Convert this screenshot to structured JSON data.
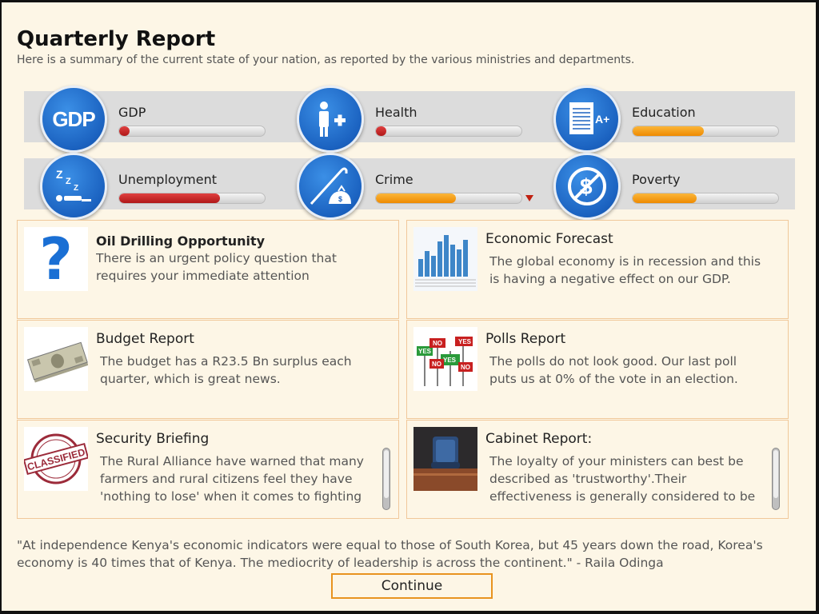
{
  "header": {
    "title": "Quarterly Report",
    "subtitle": "Here is a summary of the current state of your nation, as reported by the various ministries and departments."
  },
  "indicators": [
    {
      "label": "GDP",
      "icon": "gdp-icon",
      "icon_text": "GDP",
      "value": 0.05,
      "color": "red"
    },
    {
      "label": "Health",
      "icon": "health-icon",
      "value": 0.05,
      "color": "red"
    },
    {
      "label": "Education",
      "icon": "education-icon",
      "icon_text": "A+",
      "value": 0.49,
      "color": "orange"
    },
    {
      "label": "Unemployment",
      "icon": "sleeping-icon",
      "icon_text": "z z z",
      "value": 0.69,
      "color": "red"
    },
    {
      "label": "Crime",
      "icon": "crime-icon",
      "value": 0.55,
      "color": "orange",
      "trend": "down"
    },
    {
      "label": "Poverty",
      "icon": "no-money-icon",
      "value": 0.44,
      "color": "orange"
    }
  ],
  "reports": [
    {
      "title": "Oil Drilling Opportunity",
      "body": "There is an urgent policy question that requires your immediate attention",
      "thumb": "question-mark-icon",
      "bold": true
    },
    {
      "title": "Economic Forecast",
      "body": "The global economy is in recession and this is having a negative effect on our GDP.",
      "thumb": "bar-chart-icon"
    },
    {
      "title": "Budget Report",
      "body": "The budget has a R23.5 Bn surplus each quarter, which is great news.",
      "thumb": "money-stack-icon"
    },
    {
      "title": "Polls Report",
      "body": "The polls do not look good. Our last poll puts us at 0% of the vote in an election.",
      "thumb": "yes-no-signs-icon",
      "sign_yes": "YES",
      "sign_no": "NO"
    },
    {
      "title": "Security Briefing",
      "body": "The Rural Alliance have warned that many farmers and rural citizens feel they have 'nothing to lose' when it comes to fighting",
      "thumb": "classified-stamp-icon",
      "stamp_text": "CLASSIFIED",
      "scroll": true
    },
    {
      "title": "Cabinet Report:",
      "body": "The loyalty of your ministers can best be described as 'trustworthy'.Their effectiveness is generally considered to be",
      "thumb": "cabinet-chair-icon",
      "scroll": true
    }
  ],
  "quote": "\"At independence Kenya's economic indicators were equal to those of South Korea, but 45 years down the road, Korea's economy is 40 times that of Kenya. The mediocrity of leadership is across the continent.\" - Raila Odinga",
  "continue_label": "Continue"
}
